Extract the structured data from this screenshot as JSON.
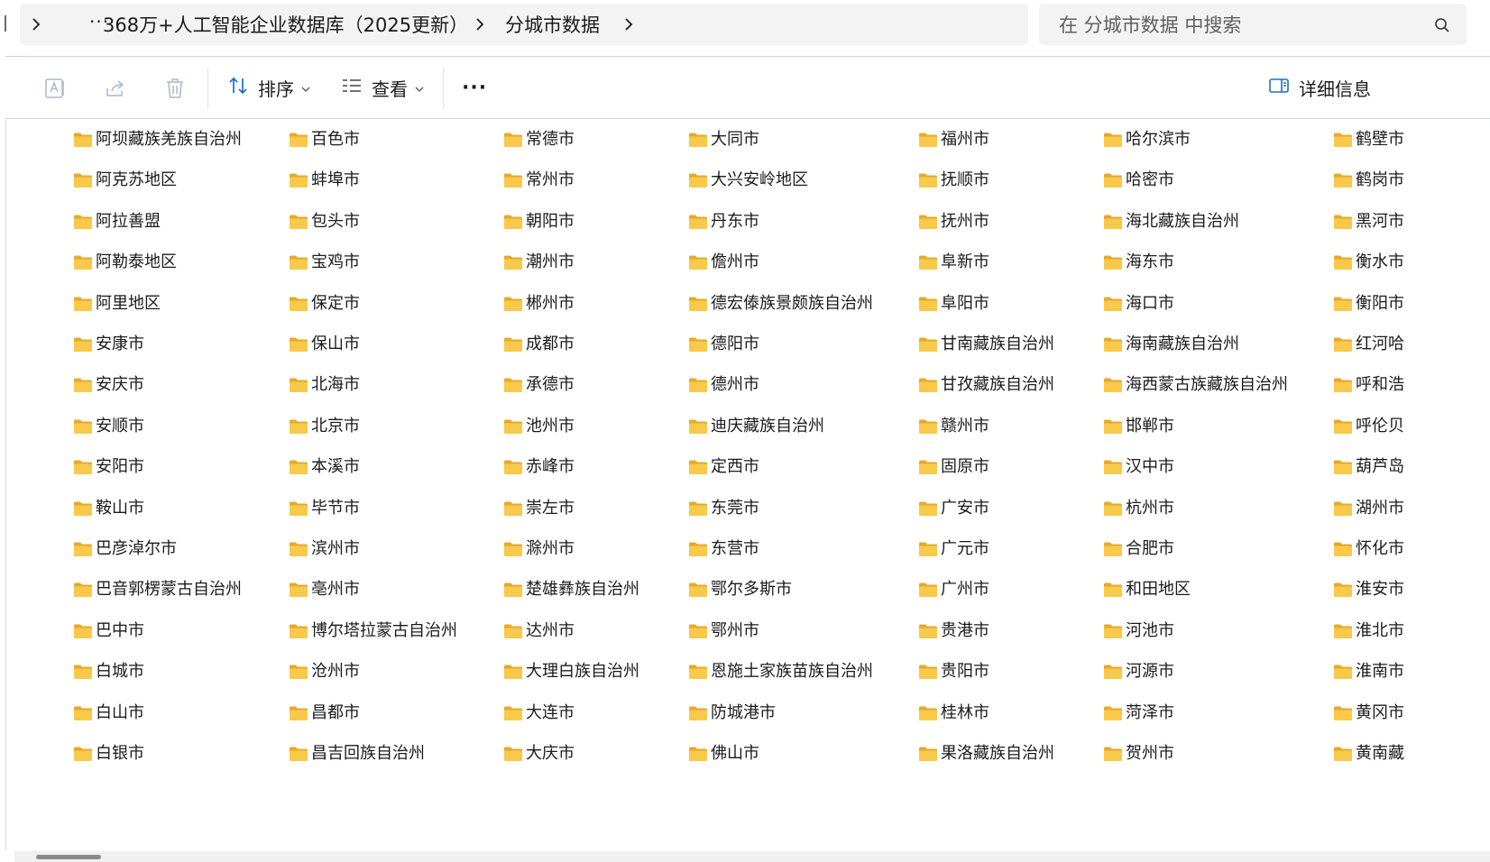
{
  "address_bar": {
    "breadcrumbs": [
      "368万+人工智能企业数据库（2025更新）",
      "分城市数据"
    ],
    "more_glyph": "···",
    "search_placeholder": "在 分城市数据 中搜索"
  },
  "toolbar": {
    "sort_label": "排序",
    "view_label": "查看",
    "more_glyph": "···",
    "details_label": "详细信息",
    "icons": [
      "rename-icon",
      "share-icon",
      "delete-icon",
      "sort-icon",
      "view-icon",
      "details-pane-icon"
    ]
  },
  "folders": {
    "columns": [
      [
        "阿坝藏族羌族自治州",
        "阿克苏地区",
        "阿拉善盟",
        "阿勒泰地区",
        "阿里地区",
        "安康市",
        "安庆市",
        "安顺市",
        "安阳市",
        "鞍山市",
        "巴彦淖尔市",
        "巴音郭楞蒙古自治州",
        "巴中市",
        "白城市",
        "白山市",
        "白银市"
      ],
      [
        "百色市",
        "蚌埠市",
        "包头市",
        "宝鸡市",
        "保定市",
        "保山市",
        "北海市",
        "北京市",
        "本溪市",
        "毕节市",
        "滨州市",
        "亳州市",
        "博尔塔拉蒙古自治州",
        "沧州市",
        "昌都市",
        "昌吉回族自治州"
      ],
      [
        "常德市",
        "常州市",
        "朝阳市",
        "潮州市",
        "郴州市",
        "成都市",
        "承德市",
        "池州市",
        "赤峰市",
        "崇左市",
        "滁州市",
        "楚雄彝族自治州",
        "达州市",
        "大理白族自治州",
        "大连市",
        "大庆市"
      ],
      [
        "大同市",
        "大兴安岭地区",
        "丹东市",
        "儋州市",
        "德宏傣族景颇族自治州",
        "德阳市",
        "德州市",
        "迪庆藏族自治州",
        "定西市",
        "东莞市",
        "东营市",
        "鄂尔多斯市",
        "鄂州市",
        "恩施土家族苗族自治州",
        "防城港市",
        "佛山市"
      ],
      [
        "福州市",
        "抚顺市",
        "抚州市",
        "阜新市",
        "阜阳市",
        "甘南藏族自治州",
        "甘孜藏族自治州",
        "赣州市",
        "固原市",
        "广安市",
        "广元市",
        "广州市",
        "贵港市",
        "贵阳市",
        "桂林市",
        "果洛藏族自治州"
      ],
      [
        "哈尔滨市",
        "哈密市",
        "海北藏族自治州",
        "海东市",
        "海口市",
        "海南藏族自治州",
        "海西蒙古族藏族自治州",
        "邯郸市",
        "汉中市",
        "杭州市",
        "合肥市",
        "和田地区",
        "河池市",
        "河源市",
        "菏泽市",
        "贺州市"
      ],
      [
        "鹤壁市",
        "鹤岗市",
        "黑河市",
        "衡水市",
        "衡阳市",
        "红河哈",
        "呼和浩",
        "呼伦贝",
        "葫芦岛",
        "湖州市",
        "怀化市",
        "淮安市",
        "淮北市",
        "淮南市",
        "黄冈市",
        "黄南藏"
      ]
    ]
  },
  "colors": {
    "folder_body": "#f8c94a",
    "folder_tab": "#e7a928",
    "accent": "#1a6fc8",
    "separator": "#c9d6e6"
  }
}
